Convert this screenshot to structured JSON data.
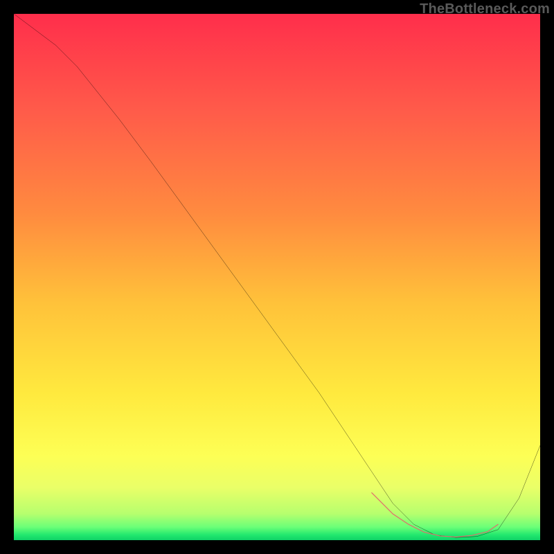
{
  "watermark": "TheBottleneck.com",
  "chart_data": {
    "type": "line",
    "title": "",
    "xlabel": "",
    "ylabel": "",
    "xlim": [
      0,
      100
    ],
    "ylim": [
      0,
      100
    ],
    "gradient_stops": [
      {
        "offset": 0.0,
        "color": "#ff2e4b"
      },
      {
        "offset": 0.18,
        "color": "#ff5a4a"
      },
      {
        "offset": 0.38,
        "color": "#ff8b3f"
      },
      {
        "offset": 0.55,
        "color": "#ffc23a"
      },
      {
        "offset": 0.72,
        "color": "#ffe93e"
      },
      {
        "offset": 0.84,
        "color": "#fdff55"
      },
      {
        "offset": 0.9,
        "color": "#eaff68"
      },
      {
        "offset": 0.95,
        "color": "#b6ff6e"
      },
      {
        "offset": 0.975,
        "color": "#6bff78"
      },
      {
        "offset": 0.99,
        "color": "#22e86e"
      },
      {
        "offset": 1.0,
        "color": "#0fd267"
      }
    ],
    "series": [
      {
        "name": "bottleneck-curve",
        "color": "#000000",
        "width": 2,
        "x": [
          0,
          4,
          8,
          12,
          16,
          20,
          26,
          34,
          42,
          50,
          58,
          64,
          68,
          72,
          76,
          80,
          84,
          88,
          92,
          96,
          100
        ],
        "y": [
          100,
          97,
          94,
          90,
          85,
          80,
          72,
          61,
          50,
          39,
          28,
          19,
          13,
          7,
          3,
          1,
          0.5,
          0.7,
          2,
          8,
          18
        ]
      },
      {
        "name": "optimal-band",
        "color": "#e06d6d",
        "width": 8,
        "linecap": "round",
        "x": [
          68,
          72,
          75,
          78,
          81,
          84,
          87,
          90,
          92
        ],
        "y": [
          9,
          5,
          3,
          1.5,
          0.8,
          0.6,
          0.9,
          1.6,
          3
        ]
      }
    ],
    "optimal_range_pct": [
      70,
      92
    ]
  }
}
